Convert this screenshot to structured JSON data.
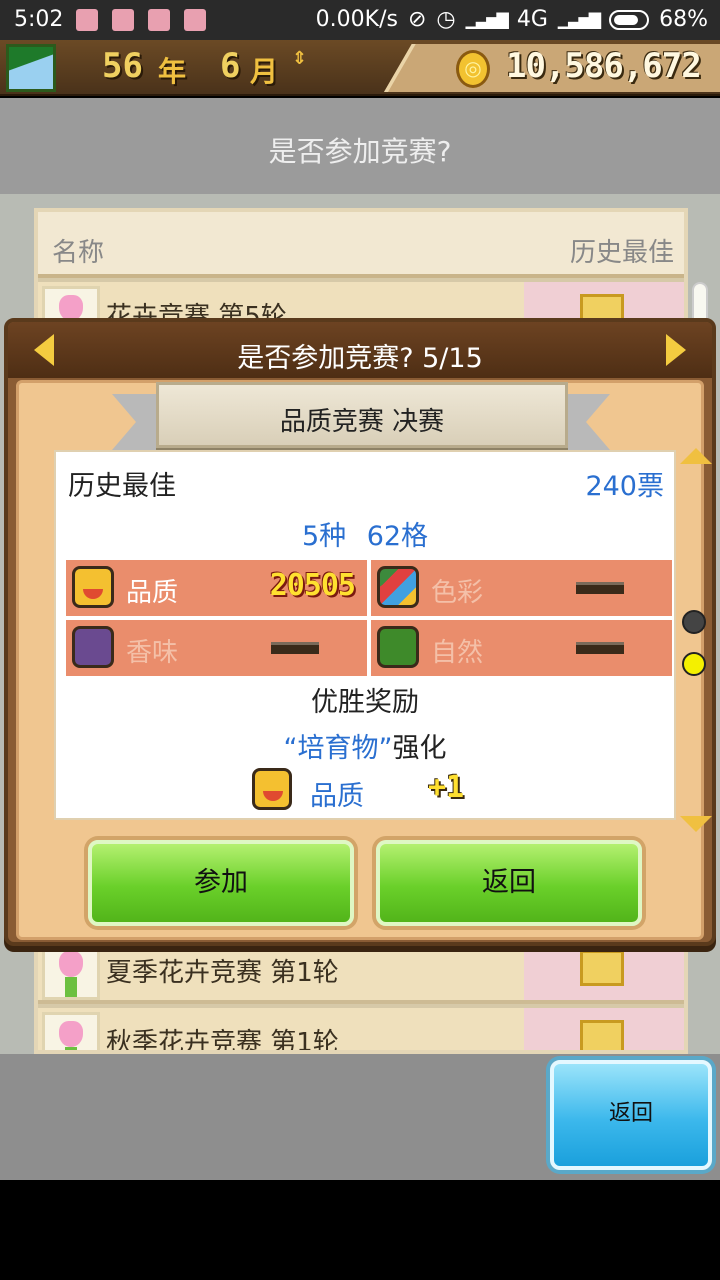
{
  "status_bar": {
    "time": "5:02",
    "net_speed": "0.00K/s",
    "network": "4G",
    "battery": "68%"
  },
  "header": {
    "year": "56",
    "year_unit": "年",
    "month": "6",
    "month_unit": "月",
    "money": "10,586,672"
  },
  "screen": {
    "title": "是否参加竞赛?"
  },
  "list": {
    "col_name": "名称",
    "col_best": "历史最佳",
    "rows": [
      {
        "name": "花卉竞赛 第5轮"
      },
      {
        "name": "夏季花卉竞赛 第1轮"
      },
      {
        "name": "秋季花卉竞赛 第1轮"
      }
    ]
  },
  "dialog": {
    "title": "是否参加竞赛? 5/15",
    "ribbon": "品质竞赛 决赛",
    "best_label": "历史最佳",
    "best_value": "240票",
    "info": "5种 62格",
    "stats": [
      {
        "label": "品质",
        "value": "20505",
        "icon": "smile-face-icon",
        "active": true
      },
      {
        "label": "色彩",
        "value": "——",
        "icon": "rainbow-icon",
        "active": false
      },
      {
        "label": "香味",
        "value": "——",
        "icon": "purple-blob-icon",
        "active": false
      },
      {
        "label": "自然",
        "value": "——",
        "icon": "leaf-circle-icon",
        "active": false
      }
    ],
    "reward_title": "优胜奖励",
    "reward_target": "“培育物”",
    "reward_action": "强化",
    "reward_stat": "品质",
    "reward_bonus": "+1",
    "join_button": "参加",
    "back_button": "返回"
  },
  "bottom": {
    "back_button": "返回"
  },
  "colors": {
    "stat_bg": "#ea8d6c",
    "link_blue": "#2a6fd0",
    "button_green": "#6ad02a",
    "button_blue": "#3cb8ec"
  }
}
